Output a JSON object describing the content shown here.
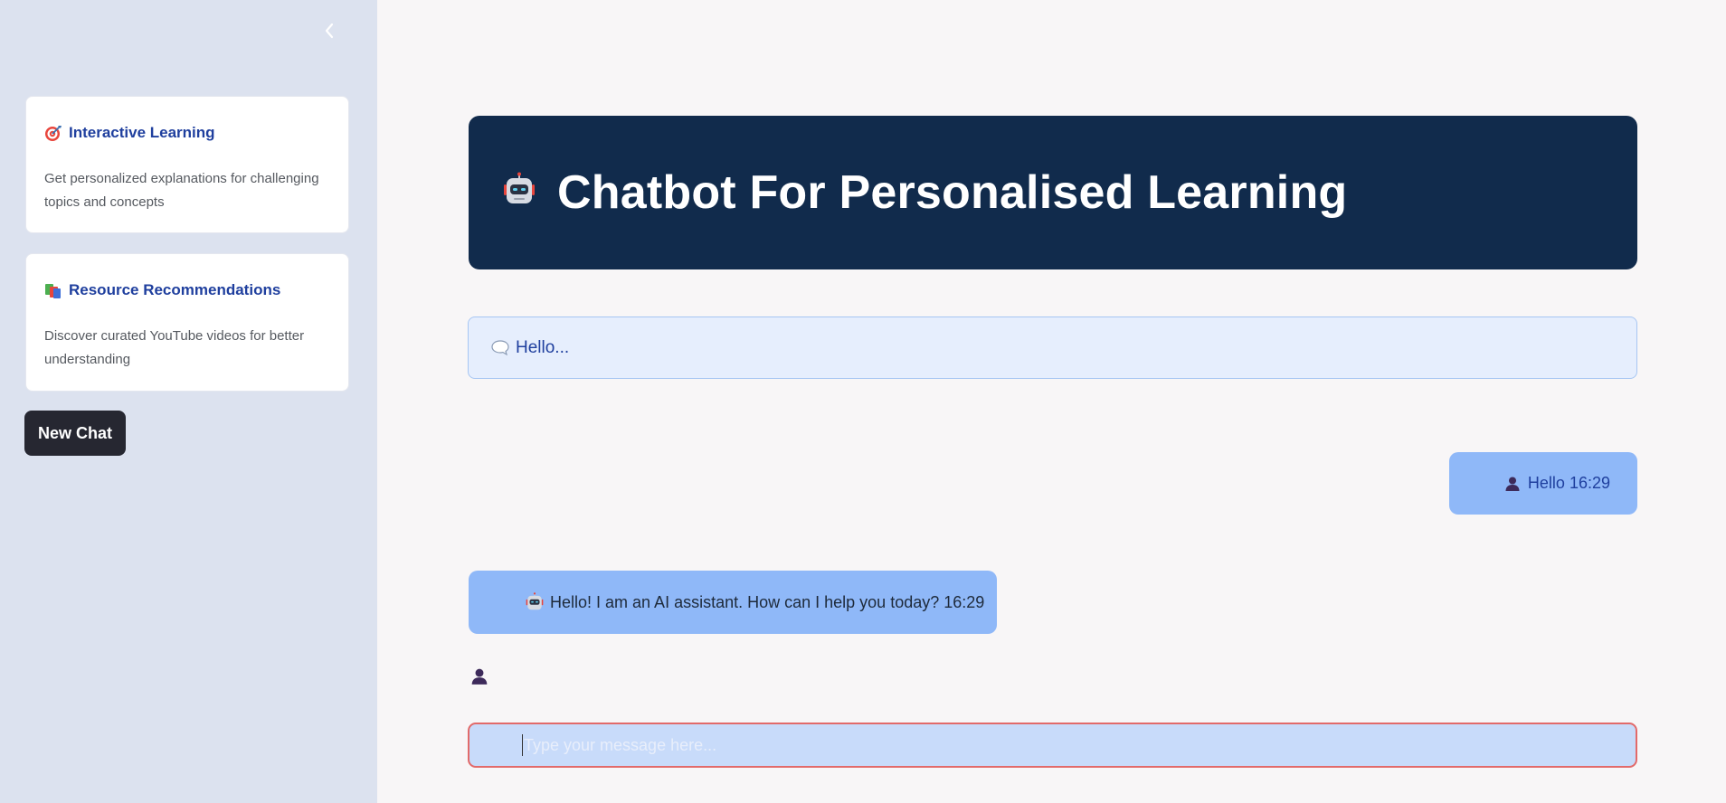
{
  "sidebar": {
    "collapse_icon": "chevron-left-icon",
    "cards": [
      {
        "icon": "target-icon",
        "title": "Interactive Learning",
        "description": "Get personalized explanations for challenging topics and concepts"
      },
      {
        "icon": "books-icon",
        "title": "Resource Recommendations",
        "description": "Discover curated YouTube videos for better understanding"
      }
    ],
    "new_chat_label": "New Chat"
  },
  "header": {
    "icon": "robot-icon",
    "title": "Chatbot For Personalised Learning"
  },
  "greeting": {
    "icon": "speech-bubble-icon",
    "text": "Hello..."
  },
  "messages": [
    {
      "role": "user",
      "icon": "user-icon",
      "text": "Hello 16:29"
    },
    {
      "role": "assistant",
      "icon": "robot-icon",
      "text": "Hello! I am an AI assistant. How can I help you today? 16:29"
    }
  ],
  "input": {
    "placeholder": "Type your message here..."
  },
  "colors": {
    "sidebar_bg": "#dce2ef",
    "header_bg": "#112b4c",
    "accent_text": "#1f3f9e",
    "message_bg": "#8fb8f8",
    "button_bg": "#262731",
    "input_border": "#e26a6a"
  }
}
